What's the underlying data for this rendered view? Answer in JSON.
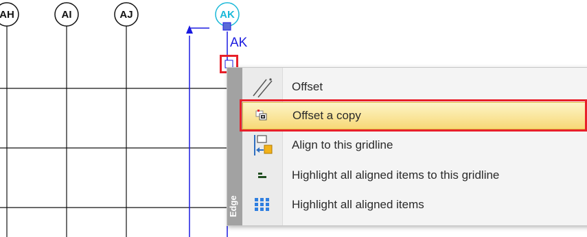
{
  "grid": {
    "bubbles": [
      {
        "id": "ah",
        "label": "AH"
      },
      {
        "id": "ai",
        "label": "AI"
      },
      {
        "id": "aj",
        "label": "AJ"
      },
      {
        "id": "ak",
        "label": "AK"
      }
    ],
    "selected_gridline_label": "AK"
  },
  "context_menu": {
    "section_label": "Edge",
    "items": [
      {
        "label": "Offset",
        "icon": "offset-line-icon"
      },
      {
        "label": "Offset a copy",
        "icon": "offset-copy-icon",
        "selected": true
      },
      {
        "label": "Align to this gridline",
        "icon": "align-gridline-icon"
      },
      {
        "label": "Highlight all aligned items to this gridline",
        "icon": "highlight-aligned-gridline-icon"
      },
      {
        "label": "Highlight all aligned items",
        "icon": "highlight-aligned-grid-icon"
      }
    ]
  },
  "colors": {
    "gridline": "#111111",
    "selected_gridline": "#1a1ae0",
    "bubble_selected": "#18b8d8",
    "highlight_box": "#e8202a",
    "menu_selected": "#f7d977"
  }
}
